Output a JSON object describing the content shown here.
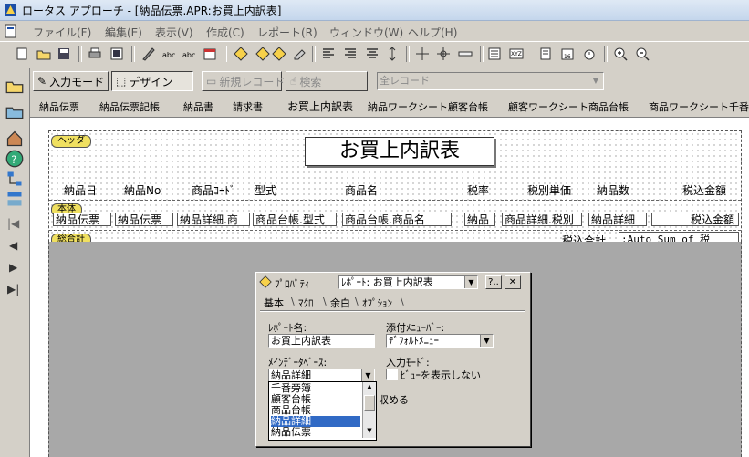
{
  "window": {
    "title": "ロータス アプローチ - [納品伝票.APR:お買上内訳表]"
  },
  "menubar": [
    "ファイル(F)",
    "編集(E)",
    "表示(V)",
    "作成(C)",
    "レポート(R)",
    "ウィンドウ(W)",
    "ヘルプ(H)"
  ],
  "modebar": {
    "input_mode": "入力モード",
    "design": "デザイン",
    "new_record": "新規レコード",
    "search": "検索",
    "record_filter": "全レコード"
  },
  "tabs": [
    "納品伝票",
    "納品伝票記帳",
    "納品書",
    "請求書",
    "お買上内訳表",
    "納品ワークシート",
    "顧客台帳",
    "顧客ワークシート",
    "商品台帳",
    "商品ワークシート",
    "千番"
  ],
  "report": {
    "header_tag": "ヘッダ",
    "title": "お買上内訳表",
    "columns": [
      "納品日",
      "納品No",
      "商品ｺｰﾄﾞ",
      "型式",
      "商品名",
      "税率",
      "税別単価",
      "納品数",
      "税込金額"
    ],
    "body_tag": "本体",
    "body_fields": [
      "納品伝票",
      "納品伝票",
      "納品詳細.商",
      "商品台帳.型式",
      "商品台帳.商品名",
      "納品",
      "商品詳細.税別",
      "納品詳細",
      "税込金額"
    ],
    "summary_tag": "総合計",
    "summary_label": "税込合計",
    "summary_field": ":Auto_Sum_of_税"
  },
  "properties_dialog": {
    "title": "ﾌﾟﾛﾊﾟﾃｨ",
    "target": "ﾚﾎﾟｰﾄ: お買上内訳表",
    "help_btn": "?..",
    "close_btn": "✕",
    "tabs": [
      "基本",
      "ﾏｸﾛ",
      "余白",
      "ｵﾌﾟｼｮﾝ"
    ],
    "report_name_label": "ﾚﾎﾟｰﾄ名:",
    "report_name_value": "お買上内訳表",
    "attached_menu_label": "添付ﾒﾆｭｰﾊﾞｰ:",
    "attached_menu_value": "ﾃﾞﾌｫﾙﾄﾒﾆｭｰ",
    "main_db_label": "ﾒｲﾝﾃﾞｰﾀﾍﾞｰｽ:",
    "main_db_value": "納品詳細",
    "input_mode_label": "入力ﾓｰﾄﾞ:",
    "view_hide_checkbox": "ﾋﾞｭｰを表示しない",
    "partial_text": "収める",
    "db_options": [
      "千番旁簿",
      "顧客台帳",
      "商品台帳",
      "納品詳細",
      "納品伝票"
    ],
    "selected_option_index": 3
  },
  "colors": {
    "selection": "#316ac5",
    "tag": "#f0e060",
    "canvas_gray": "#a8a8a8"
  }
}
